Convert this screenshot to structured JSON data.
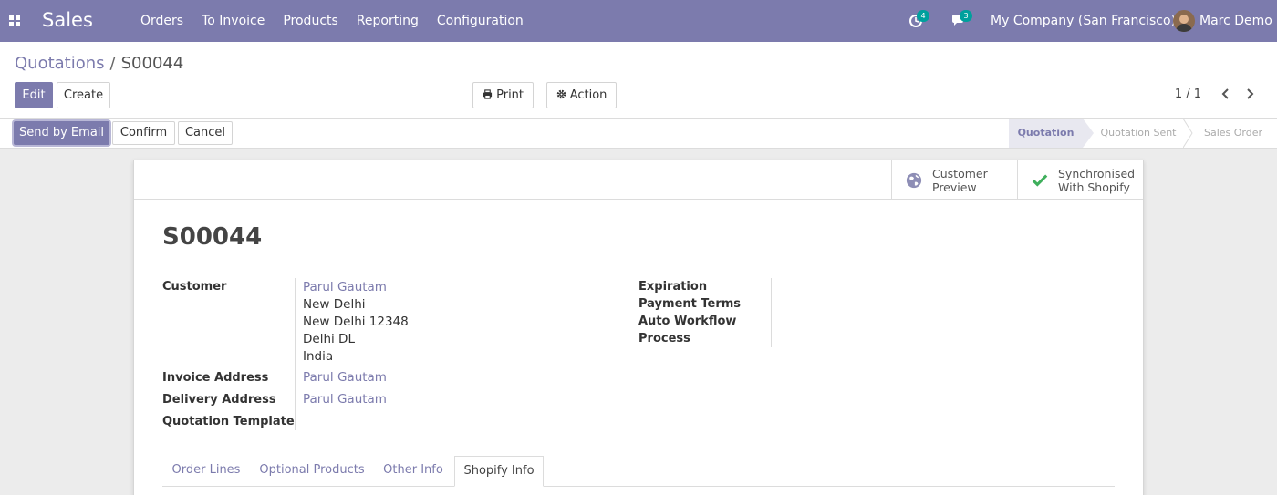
{
  "navbar": {
    "app_name": "Sales",
    "menu": [
      "Orders",
      "To Invoice",
      "Products",
      "Reporting",
      "Configuration"
    ],
    "activity_count": "4",
    "message_count": "3",
    "company": "My Company (San Francisco)",
    "user": "Marc Demo"
  },
  "breadcrumb": {
    "parent": "Quotations",
    "separator": "/",
    "current": "S00044"
  },
  "actions": {
    "edit": "Edit",
    "create": "Create",
    "print": "Print",
    "action": "Action"
  },
  "pager": {
    "value": "1 / 1"
  },
  "status_buttons": {
    "send_email": "Send by Email",
    "confirm": "Confirm",
    "cancel": "Cancel"
  },
  "stages": [
    "Quotation",
    "Quotation Sent",
    "Sales Order"
  ],
  "active_stage": "Quotation",
  "smart_buttons": {
    "preview_line1": "Customer",
    "preview_line2": "Preview",
    "shopify_line1": "Synchronised",
    "shopify_line2": "With Shopify"
  },
  "form": {
    "name": "S00044",
    "customer_label": "Customer",
    "customer_name": "Parul Gautam",
    "customer_address": [
      "New Delhi",
      "New Delhi 12348",
      "Delhi DL",
      "India"
    ],
    "invoice_address_label": "Invoice Address",
    "invoice_address": "Parul Gautam",
    "delivery_address_label": "Delivery Address",
    "delivery_address": "Parul Gautam",
    "template_label": "Quotation Template",
    "expiration_label": "Expiration",
    "payment_terms_label": "Payment Terms",
    "auto_workflow_label": "Auto Workflow",
    "process_label": "Process"
  },
  "tabs": [
    "Order Lines",
    "Optional Products",
    "Other Info",
    "Shopify Info"
  ],
  "active_tab": "Shopify Info",
  "colors": {
    "primary": "#7c7bad",
    "badge": "#00a09d",
    "success": "#3faf5c"
  }
}
